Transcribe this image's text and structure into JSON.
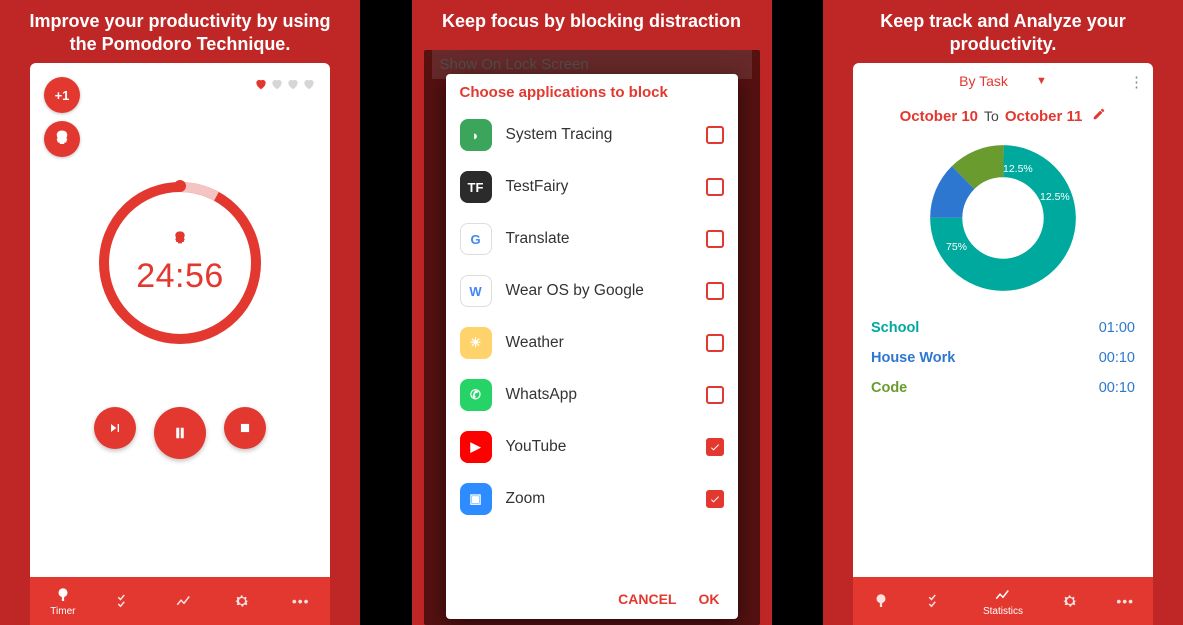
{
  "panel1": {
    "headline": "Improve your productivity by using the Pomodoro Technique.",
    "plus1_label": "+1",
    "timer_time": "24:56",
    "hearts_filled": 1,
    "hearts_total": 4,
    "bottom": {
      "timer": "Timer",
      "tasks": "",
      "stats": "",
      "settings": "",
      "more": ""
    }
  },
  "panel2": {
    "headline": "Keep focus by blocking distraction",
    "bg_setting": "Show On Lock Screen",
    "dialog_title": "Choose applications to block",
    "apps": [
      {
        "name": "System Tracing",
        "checked": false,
        "icon_bg": "#3ba55c",
        "icon_glyph": "◗"
      },
      {
        "name": "TestFairy",
        "checked": false,
        "icon_bg": "#2b2b2b",
        "icon_glyph": "TF"
      },
      {
        "name": "Translate",
        "checked": false,
        "icon_bg": "#ffffff",
        "icon_glyph": "G"
      },
      {
        "name": "Wear OS by Google",
        "checked": false,
        "icon_bg": "#ffffff",
        "icon_glyph": "W"
      },
      {
        "name": "Weather",
        "checked": false,
        "icon_bg": "#ffd36b",
        "icon_glyph": "☀"
      },
      {
        "name": "WhatsApp",
        "checked": false,
        "icon_bg": "#25d366",
        "icon_glyph": "✆"
      },
      {
        "name": "YouTube",
        "checked": true,
        "icon_bg": "#ff0000",
        "icon_glyph": "▶"
      },
      {
        "name": "Zoom",
        "checked": true,
        "icon_bg": "#2d8cff",
        "icon_glyph": "▣"
      }
    ],
    "cancel": "CANCEL",
    "ok": "OK"
  },
  "panel3": {
    "headline": "Keep track and Analyze your productivity.",
    "dropdown": "By Task",
    "date_from": "October 10",
    "date_to_word": "To",
    "date_to": "October 11",
    "chart_data": {
      "type": "pie",
      "title": "",
      "series": [
        {
          "name": "School",
          "value": 75,
          "color": "#00a99d",
          "label": "75%"
        },
        {
          "name": "House Work",
          "value": 12.5,
          "color": "#2e77d0",
          "label": "12.5%"
        },
        {
          "name": "Code",
          "value": 12.5,
          "color": "#6a9b2f",
          "label": "12.5%"
        }
      ]
    },
    "stats": [
      {
        "name": "School",
        "time": "01:00",
        "cls": "teal"
      },
      {
        "name": "House Work",
        "time": "00:10",
        "cls": "blue"
      },
      {
        "name": "Code",
        "time": "00:10",
        "cls": "green"
      }
    ],
    "bottom": {
      "stats_label": "Statistics"
    }
  }
}
